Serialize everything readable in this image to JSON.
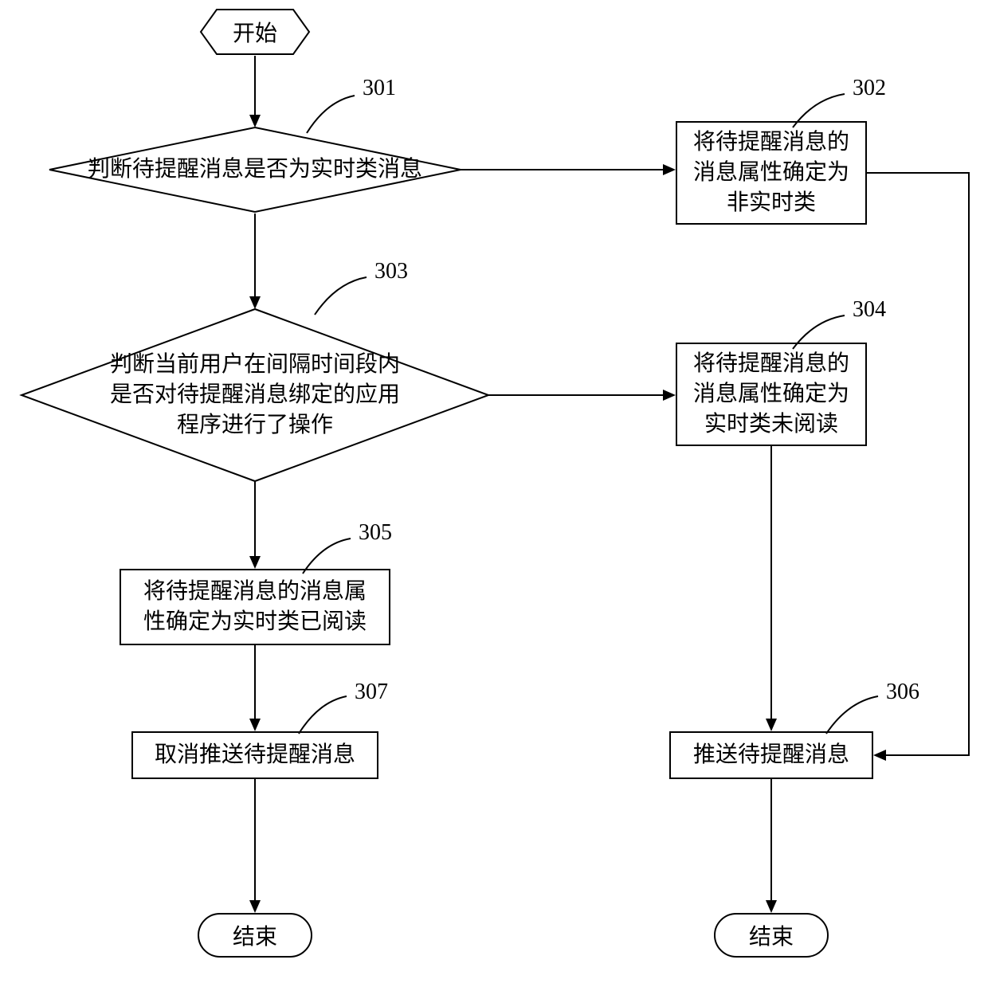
{
  "chart_data": {
    "type": "flowchart",
    "title": "",
    "nodes": [
      {
        "id": "start",
        "kind": "start",
        "shape": "hexagon",
        "text": "开始"
      },
      {
        "id": "n301",
        "kind": "decision",
        "shape": "diamond",
        "step": "301",
        "text": "判断待提醒消息是否为实时类消息"
      },
      {
        "id": "n302",
        "kind": "process",
        "shape": "rectangle",
        "step": "302",
        "text": "将待提醒消息的\n消息属性确定为\n非实时类"
      },
      {
        "id": "n303",
        "kind": "decision",
        "shape": "diamond",
        "step": "303",
        "text": "判断当前用户在间隔时间段内\n是否对待提醒消息绑定的应用\n程序进行了操作"
      },
      {
        "id": "n304",
        "kind": "process",
        "shape": "rectangle",
        "step": "304",
        "text": "将待提醒消息的\n消息属性确定为\n实时类未阅读"
      },
      {
        "id": "n305",
        "kind": "process",
        "shape": "rectangle",
        "step": "305",
        "text": "将待提醒消息的消息属\n性确定为实时类已阅读"
      },
      {
        "id": "n306",
        "kind": "process",
        "shape": "rectangle",
        "step": "306",
        "text": "推送待提醒消息"
      },
      {
        "id": "n307",
        "kind": "process",
        "shape": "rectangle",
        "step": "307",
        "text": "取消推送待提醒消息"
      },
      {
        "id": "end_l",
        "kind": "end",
        "shape": "stadium",
        "text": "结束"
      },
      {
        "id": "end_r",
        "kind": "end",
        "shape": "stadium",
        "text": "结束"
      }
    ],
    "edges": [
      {
        "from": "start",
        "to": "n301"
      },
      {
        "from": "n301",
        "to": "n302",
        "branch": "no"
      },
      {
        "from": "n301",
        "to": "n303",
        "branch": "yes"
      },
      {
        "from": "n303",
        "to": "n304",
        "branch": "no"
      },
      {
        "from": "n303",
        "to": "n305",
        "branch": "yes"
      },
      {
        "from": "n305",
        "to": "n307"
      },
      {
        "from": "n307",
        "to": "end_l"
      },
      {
        "from": "n304",
        "to": "n306"
      },
      {
        "from": "n302",
        "to": "n306"
      },
      {
        "from": "n306",
        "to": "end_r"
      }
    ]
  },
  "labels": {
    "start": "开始",
    "n301": "判断待提醒消息是否为实时类消息",
    "n302_l1": "将待提醒消息的",
    "n302_l2": "消息属性确定为",
    "n302_l3": "非实时类",
    "n303_l1": "判断当前用户在间隔时间段内",
    "n303_l2": "是否对待提醒消息绑定的应用",
    "n303_l3": "程序进行了操作",
    "n304_l1": "将待提醒消息的",
    "n304_l2": "消息属性确定为",
    "n304_l3": "实时类未阅读",
    "n305_l1": "将待提醒消息的消息属",
    "n305_l2": "性确定为实时类已阅读",
    "n306": "推送待提醒消息",
    "n307": "取消推送待提醒消息",
    "end": "结束"
  },
  "steps": {
    "s301": "301",
    "s302": "302",
    "s303": "303",
    "s304": "304",
    "s305": "305",
    "s306": "306",
    "s307": "307"
  }
}
